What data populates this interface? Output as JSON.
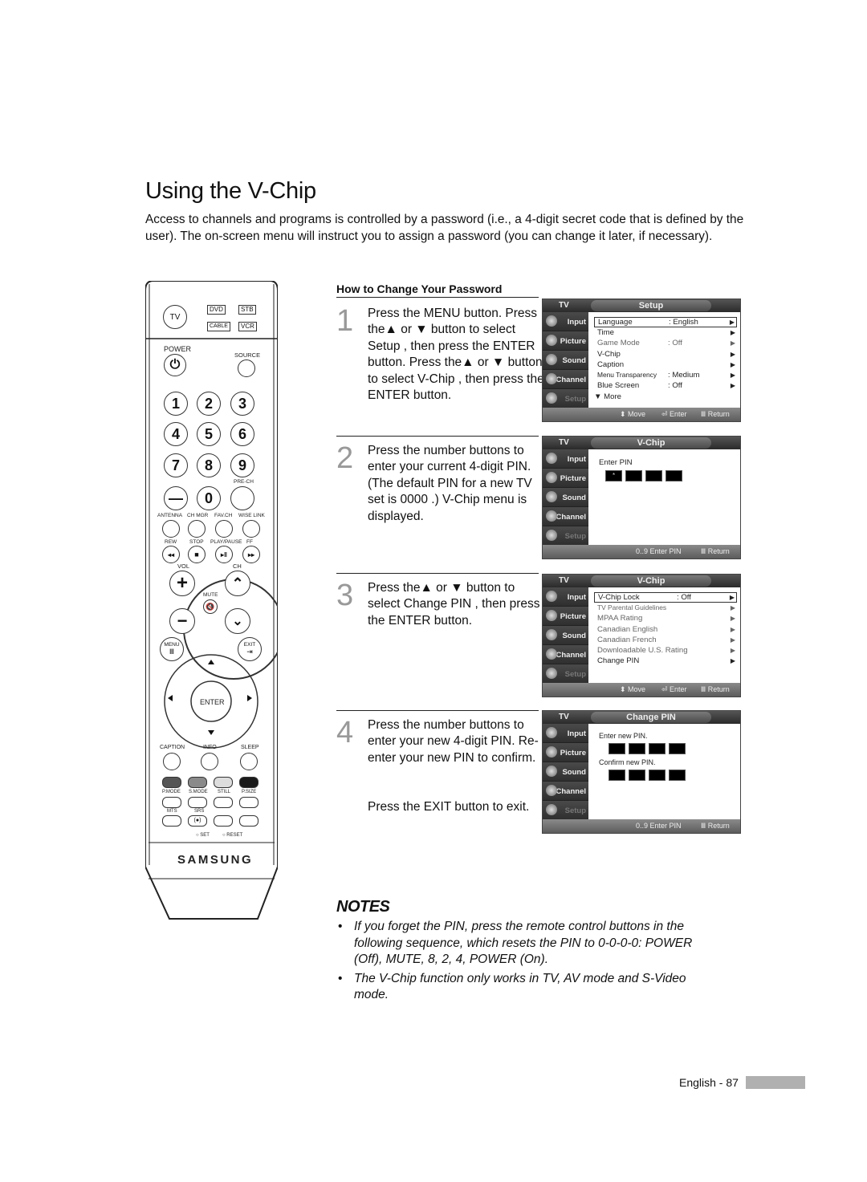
{
  "page": {
    "title": "Using the V-Chip",
    "intro": "Access to channels and programs is controlled by a password (i.e., a 4-digit secret code that is defined by the user). The on-screen menu will instruct you to assign a password (you can change it later, if necessary).",
    "section_heading": "How to Change Your Password",
    "footer_text": "English - 87"
  },
  "steps": [
    {
      "number": "1",
      "text": "Press the MENU button. Press the▲ or ▼ button to select  Setup , then press the ENTER button. Press the▲ or ▼ button to select  V-Chip , then press the ENTER button."
    },
    {
      "number": "2",
      "text": "Press the number buttons to enter your current 4-digit PIN. (The default PIN for a new TV set is  0000 .)  V-Chip  menu is displayed."
    },
    {
      "number": "3",
      "text": "Press the▲ or ▼ button to select  Change PIN , then press the ENTER button."
    },
    {
      "number": "4",
      "text": "Press the number buttons to enter your new 4-digit PIN. Re-enter your new PIN to confirm.",
      "extra": "Press the EXIT button to exit."
    }
  ],
  "osd_common": {
    "tv_label": "TV",
    "sidebar": [
      "Input",
      "Picture",
      "Sound",
      "Channel",
      "Setup"
    ],
    "foot_move": "⬍ Move",
    "foot_enter": "⏎ Enter",
    "foot_return": "Ⅲ Return",
    "foot_enter_pin": "0..9 Enter PIN"
  },
  "osd_screens": [
    {
      "caption": "Setup",
      "rows": [
        {
          "label": "Language",
          "value": ": English",
          "selected": true
        },
        {
          "label": "Time",
          "value": ""
        },
        {
          "label": "Game Mode",
          "value": ": Off"
        },
        {
          "label": "V-Chip",
          "value": ""
        },
        {
          "label": "Caption",
          "value": ""
        },
        {
          "label": "Menu Transparency",
          "value": ": Medium"
        },
        {
          "label": "Blue Screen",
          "value": ": Off"
        }
      ],
      "more": "▼ More"
    },
    {
      "caption": "V-Chip",
      "prompt": "Enter PIN",
      "pin_first": "*"
    },
    {
      "caption": "V-Chip",
      "rows": [
        {
          "label": "V-Chip Lock",
          "value": ": Off",
          "selected": true
        },
        {
          "label": "TV Parental Guidelines",
          "value": ""
        },
        {
          "label": "MPAA Rating",
          "value": ""
        },
        {
          "label": "Canadian English",
          "value": ""
        },
        {
          "label": "Canadian French",
          "value": ""
        },
        {
          "label": "Downloadable U.S. Rating",
          "value": ""
        },
        {
          "label": "Change PIN",
          "value": ""
        }
      ]
    },
    {
      "caption": "Change PIN",
      "prompt1": "Enter new PIN.",
      "prompt2": "Confirm new PIN."
    }
  ],
  "notes": {
    "title": "NOTES",
    "items": [
      "If you forget the PIN, press the remote control buttons in the following sequence, which resets the PIN to 0-0-0-0: POWER (Off), MUTE, 8, 2, 4, POWER (On).",
      "The V-Chip function only works in TV, AV mode and S-Video mode."
    ]
  },
  "remote": {
    "tv": "TV",
    "dvd": "DVD",
    "stb": "STB",
    "cable": "CABLE",
    "vcr": "VCR",
    "power": "POWER",
    "source": "SOURCE",
    "digits": [
      "1",
      "2",
      "3",
      "4",
      "5",
      "6",
      "7",
      "8",
      "9",
      "—",
      "0"
    ],
    "prech": "PRE-CH",
    "row_labels": [
      "ANTENNA",
      "CH MGR",
      "FAV.CH",
      "WISE LINK"
    ],
    "transport_labels": [
      "REW",
      "STOP",
      "PLAY/PAUSE",
      "FF"
    ],
    "transport_icons": [
      "◂◂",
      "■",
      "▸ǁ",
      "▸▸"
    ],
    "vol": "VOL",
    "ch": "CH",
    "mute": "MUTE",
    "menu": "MENU",
    "exit": "EXIT",
    "enter": "ENTER",
    "func_labels": [
      "CAPTION",
      "INFO",
      "SLEEP"
    ],
    "color_labels": [
      "P.MODE",
      "S.MODE",
      "STILL",
      "P.SIZE"
    ],
    "color_buttons": [
      "#555555",
      "#8a8a8a",
      "#dddddd",
      "#1a1a1a"
    ],
    "mts": "MTS",
    "srs": "SRS",
    "srs_icon": "(●)",
    "set": "SET",
    "reset": "RESET",
    "brand": "SAMSUNG"
  }
}
